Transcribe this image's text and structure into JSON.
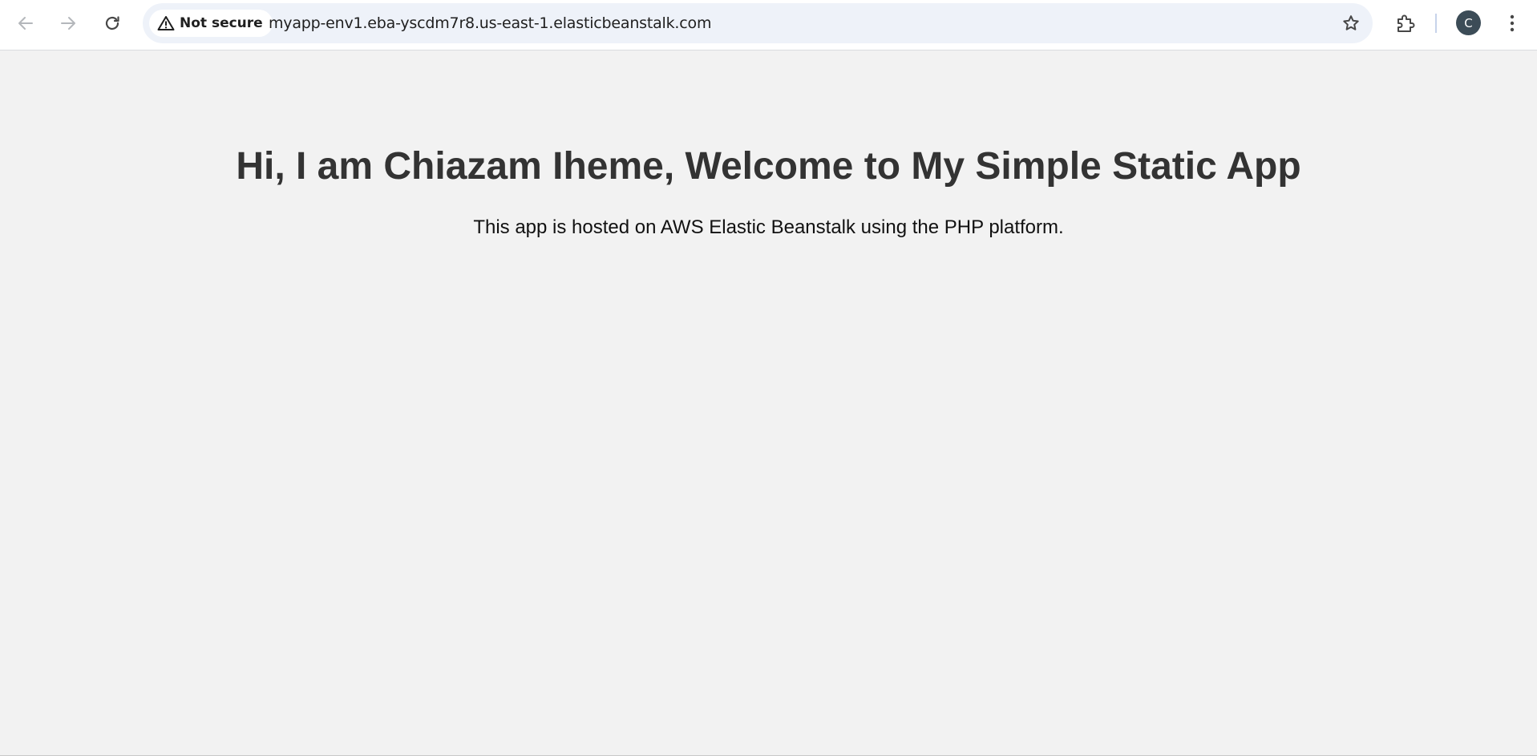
{
  "browser": {
    "security_label": "Not secure",
    "url": "myapp-env1.eba-yscdm7r8.us-east-1.elasticbeanstalk.com",
    "profile_initial": "C",
    "icons": {
      "back": "arrow-left-icon",
      "forward": "arrow-right-icon",
      "reload": "reload-icon",
      "security": "warning-triangle-icon",
      "bookmark": "star-icon",
      "extensions": "puzzle-icon",
      "menu": "kebab-menu-icon"
    },
    "colors": {
      "omnibox_bg": "#eef2f9",
      "avatar_bg": "#3c4c57",
      "page_bg": "#f2f2f2"
    }
  },
  "page": {
    "title": "Hi, I am Chiazam Iheme, Welcome to My Simple Static App",
    "subtitle": "This app is hosted on AWS Elastic Beanstalk using the PHP platform."
  }
}
